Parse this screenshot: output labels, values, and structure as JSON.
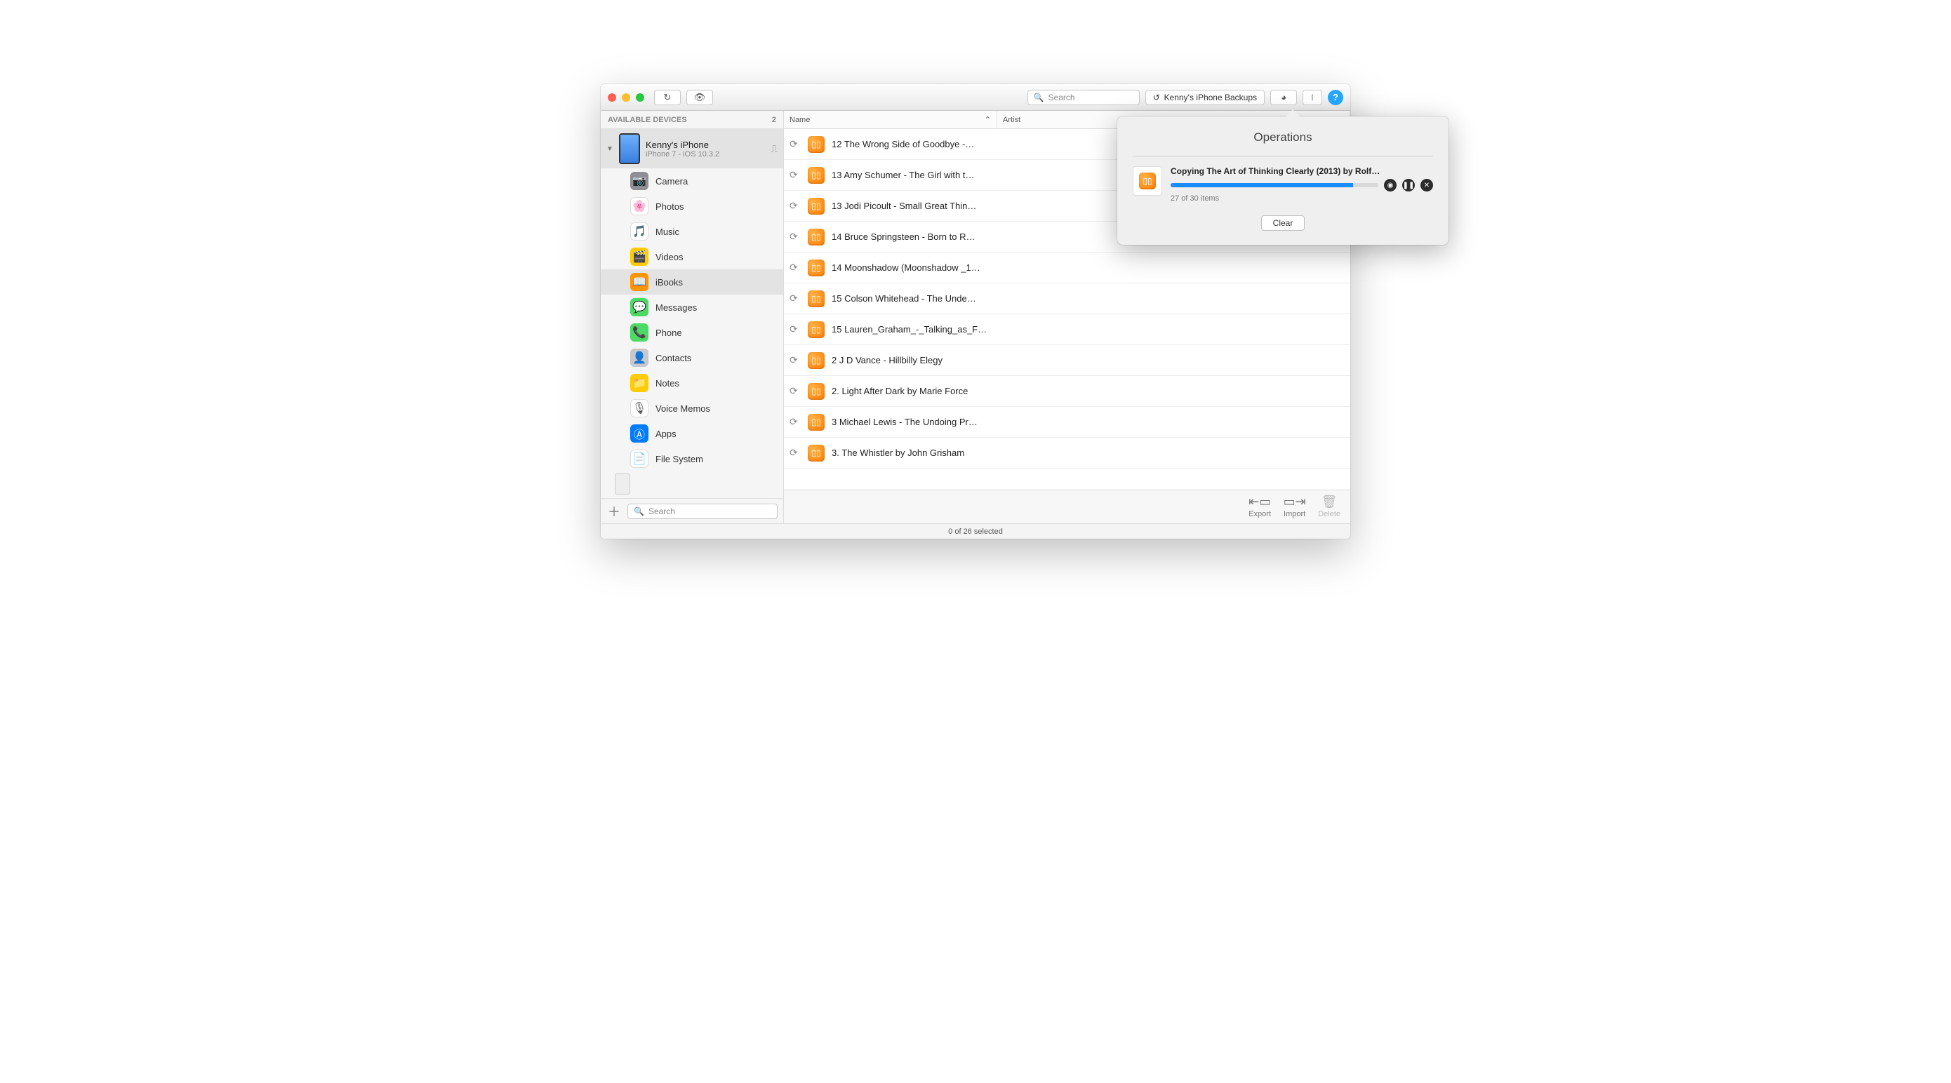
{
  "toolbar": {
    "search_placeholder": "Search",
    "backups_label": "Kenny's iPhone Backups"
  },
  "sidebar": {
    "header": "AVAILABLE DEVICES",
    "count": "2",
    "device": {
      "name": "Kenny's iPhone",
      "subtitle": "iPhone 7 - iOS 10.3.2"
    },
    "items": [
      {
        "label": "Camera",
        "bg": "#8e8e93",
        "glyph": "📷"
      },
      {
        "label": "Photos",
        "bg": "#ffffff",
        "glyph": "🌸"
      },
      {
        "label": "Music",
        "bg": "#ffffff",
        "glyph": "🎵"
      },
      {
        "label": "Videos",
        "bg": "#ffcc00",
        "glyph": "🎬"
      },
      {
        "label": "iBooks",
        "bg": "#ff9500",
        "glyph": "📖"
      },
      {
        "label": "Messages",
        "bg": "#4cd964",
        "glyph": "💬"
      },
      {
        "label": "Phone",
        "bg": "#4cd964",
        "glyph": "📞"
      },
      {
        "label": "Contacts",
        "bg": "#c7c7cc",
        "glyph": "👤"
      },
      {
        "label": "Notes",
        "bg": "#ffcc00",
        "glyph": "📁"
      },
      {
        "label": "Voice Memos",
        "bg": "#ffffff",
        "glyph": "🎙"
      },
      {
        "label": "Apps",
        "bg": "#007aff",
        "glyph": "Ⓐ"
      },
      {
        "label": "File System",
        "bg": "#ffffff",
        "glyph": "📄"
      }
    ],
    "active_index": 4,
    "search_placeholder": "Search"
  },
  "columns": {
    "name": "Name",
    "artist": "Artist"
  },
  "rows": [
    {
      "name": "12 The Wrong Side of Goodbye -…"
    },
    {
      "name": "13 Amy Schumer - The Girl with t…"
    },
    {
      "name": "13 Jodi Picoult - Small Great Thin…"
    },
    {
      "name": "14 Bruce Springsteen - Born to R…"
    },
    {
      "name": "14 Moonshadow (Moonshadow _1…"
    },
    {
      "name": "15 Colson Whitehead - The Unde…"
    },
    {
      "name": "15 Lauren_Graham_-_Talking_as_F…"
    },
    {
      "name": "2 J D Vance - Hillbilly Elegy"
    },
    {
      "name": "2. Light After Dark by Marie Force"
    },
    {
      "name": "3 Michael Lewis - The Undoing Pr…"
    },
    {
      "name": "3. The Whistler by John Grisham"
    }
  ],
  "footer": {
    "export": "Export",
    "import": "Import",
    "delete": "Delete"
  },
  "status": "0 of 26 selected",
  "popover": {
    "title": "Operations",
    "op_name": "Copying The Art of Thinking Clearly (2013) by Rolf…",
    "op_sub": "27 of 30 items",
    "progress_pct": 88,
    "clear": "Clear"
  }
}
